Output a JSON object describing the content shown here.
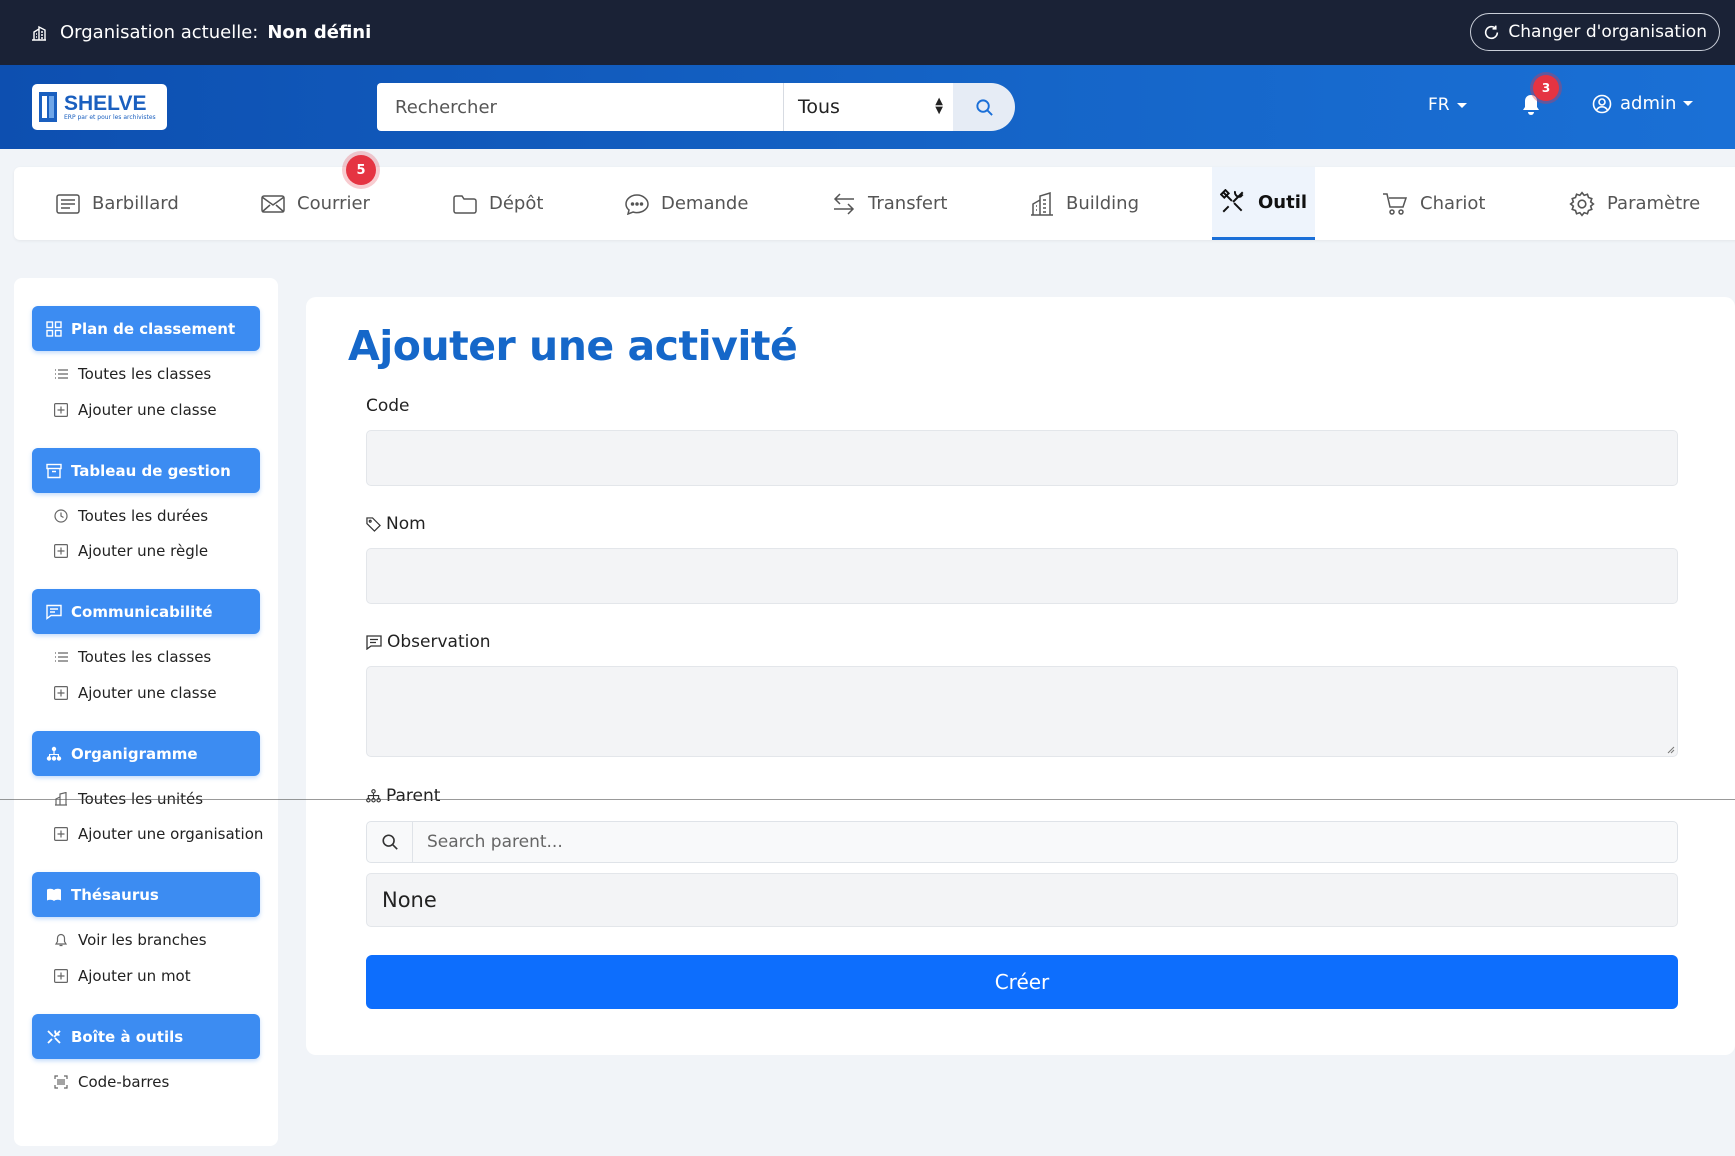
{
  "orgbar": {
    "label": "Organisation actuelle:",
    "value": "Non défini",
    "switch_label": "Changer d'organisation"
  },
  "header": {
    "logo_name": "SHELVE",
    "logo_tagline": "ERP par et pour les archivistes",
    "search_placeholder": "Rechercher",
    "search_scope": "Tous",
    "language": "FR",
    "notification_count": "3",
    "user": "admin"
  },
  "tabs": [
    {
      "label": "Barbillard",
      "icon": "newspaper-icon"
    },
    {
      "label": "Courrier",
      "icon": "envelope-icon",
      "badge": "5"
    },
    {
      "label": "Dépôt",
      "icon": "folder-icon"
    },
    {
      "label": "Demande",
      "icon": "chat-icon"
    },
    {
      "label": "Transfert",
      "icon": "arrows-icon"
    },
    {
      "label": "Building",
      "icon": "building-icon"
    },
    {
      "label": "Outil",
      "icon": "tools-icon",
      "active": true
    },
    {
      "label": "Chariot",
      "icon": "cart-icon"
    },
    {
      "label": "Paramètre",
      "icon": "gear-icon"
    }
  ],
  "sidebar": {
    "sections": [
      {
        "title": "Plan de classement",
        "items": [
          "Toutes les classes",
          "Ajouter une classe"
        ]
      },
      {
        "title": "Tableau de gestion",
        "items": [
          "Toutes les durées",
          "Ajouter une règle"
        ]
      },
      {
        "title": "Communicabilité",
        "items": [
          "Toutes les classes",
          "Ajouter une classe"
        ]
      },
      {
        "title": "Organigramme",
        "items": [
          "Toutes les unités",
          "Ajouter une organisation"
        ]
      },
      {
        "title": "Thésaurus",
        "items": [
          "Voir les branches",
          "Ajouter un mot"
        ]
      },
      {
        "title": "Boîte à outils",
        "items": [
          "Code-barres"
        ]
      }
    ]
  },
  "form": {
    "title": "Ajouter une activité",
    "code_label": "Code",
    "name_label": "Nom",
    "observation_label": "Observation",
    "parent_label": "Parent",
    "parent_search_placeholder": "Search parent...",
    "parent_value": "None",
    "submit_label": "Créer"
  },
  "colors": {
    "primary": "#0d6efd",
    "header_blue": "#1565c8",
    "sidebar_head": "#3c8cf2",
    "title": "#1567c9",
    "badge": "#e53442",
    "dark_bar": "#1a2236"
  }
}
